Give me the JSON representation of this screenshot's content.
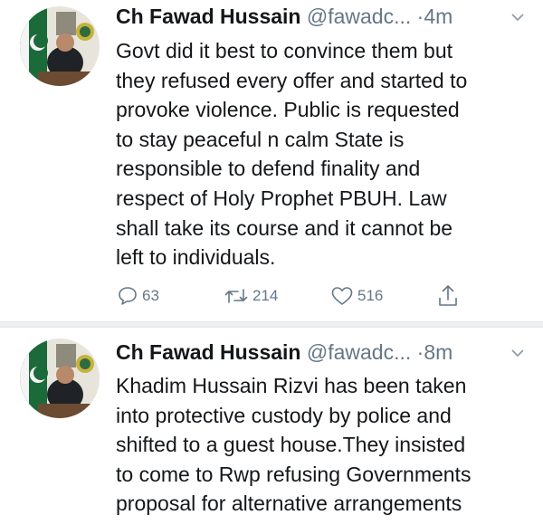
{
  "tweets": [
    {
      "author_name": "Ch Fawad Hussain",
      "handle": "@fawadc...",
      "time": "·4m",
      "body_lines": [
        "Govt did it best to convince them but",
        "they refused every offer and started to",
        "provoke violence. Public is requested",
        "to stay peaceful n calm State is",
        "responsible to defend finality and",
        "respect of Holy Prophet PBUH. Law",
        "shall take its course and it cannot be",
        "left to individuals."
      ],
      "replies": "63",
      "retweets": "214",
      "likes": "516"
    },
    {
      "author_name": "Ch Fawad Hussain",
      "handle": "@fawadc...",
      "time": "·8m",
      "body_lines": [
        "Khadim Hussain Rizvi has been taken",
        "into protective custody by police and",
        "shifted to a guest house.They insisted",
        "to come to Rwp refusing Governments",
        "proposal for alternative arrangements"
      ]
    }
  ],
  "icons": {
    "reply": "reply-icon",
    "retweet": "retweet-icon",
    "like": "heart-icon",
    "share": "share-icon",
    "menu": "chevron-down-icon"
  },
  "colors": {
    "text": "#14171a",
    "secondary": "#657786",
    "flag_green": "#1b6b3a",
    "separator": "#eef0f2"
  }
}
